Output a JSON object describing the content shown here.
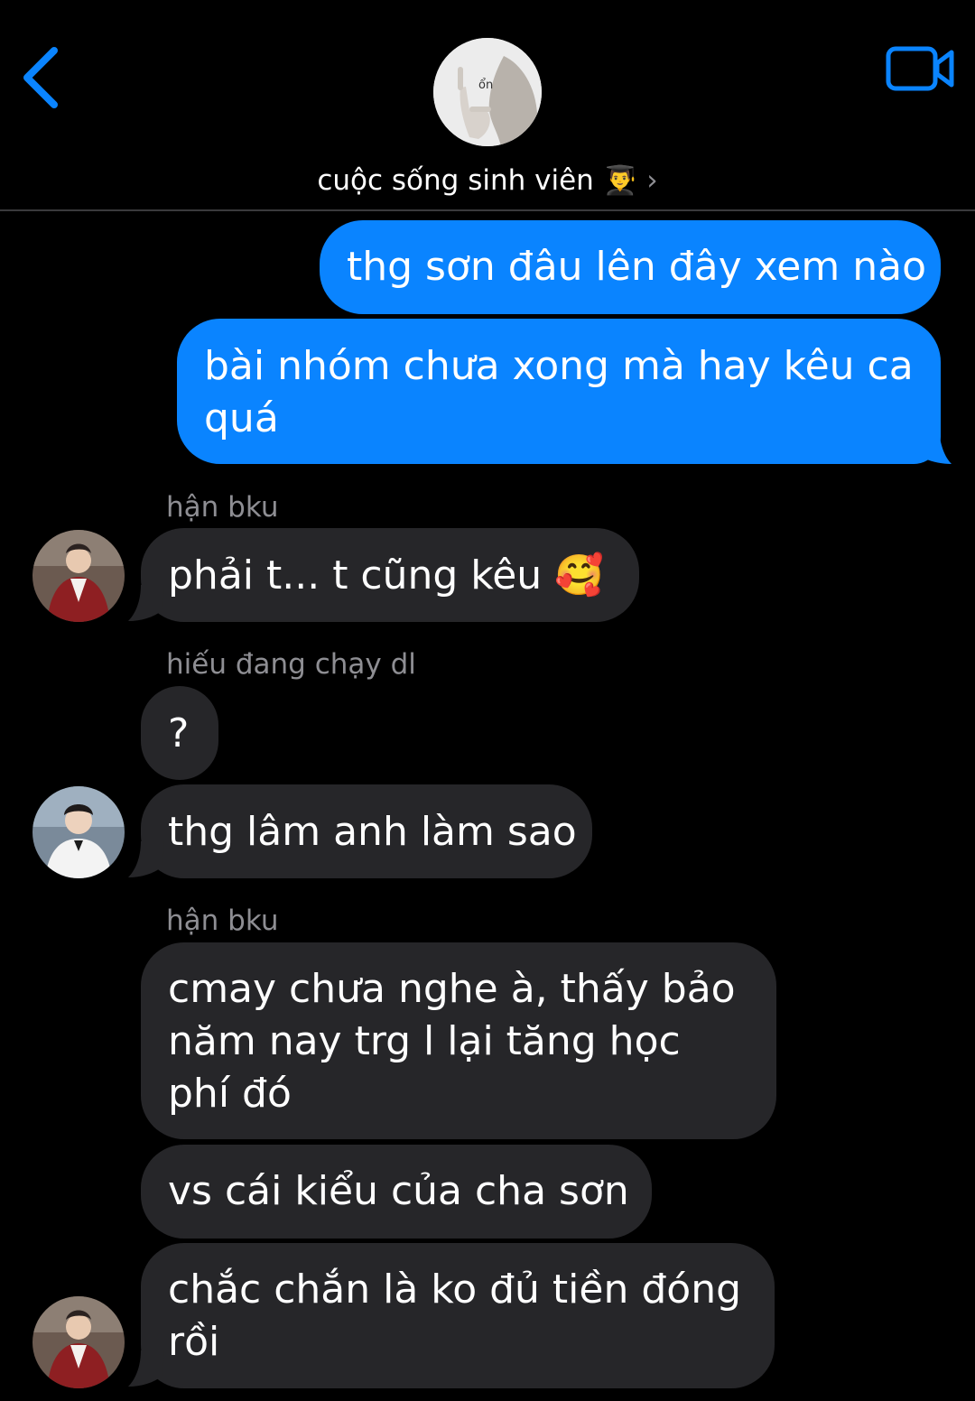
{
  "header": {
    "group_name": "cuộc sống sinh viên 👨‍🎓",
    "chevron": "›",
    "group_avatar_text": "ổn",
    "back_icon": "chevron-left-icon",
    "video_icon": "video-camera-icon",
    "accent_color": "#0a84ff"
  },
  "messages": [
    {
      "direction": "out",
      "text": "thg sơn đâu lên đây xem nào"
    },
    {
      "direction": "out",
      "text": "bài nhóm chưa xong mà hay kêu ca quá"
    },
    {
      "direction": "in",
      "sender": "hận bku",
      "text": "phải t... t cũng kêu 🥰"
    },
    {
      "direction": "in",
      "sender": "hiếu đang chạy dl",
      "text": "?"
    },
    {
      "direction": "in",
      "text": "thg lâm anh làm sao"
    },
    {
      "direction": "in",
      "sender": "hận bku",
      "text": "cmay chưa nghe à, thấy bảo năm nay trg l lại tăng học phí đó"
    },
    {
      "direction": "in",
      "text": "vs cái kiểu của cha sơn"
    },
    {
      "direction": "in",
      "text": "chắc chắn là ko đủ tiền đóng rồi"
    }
  ]
}
